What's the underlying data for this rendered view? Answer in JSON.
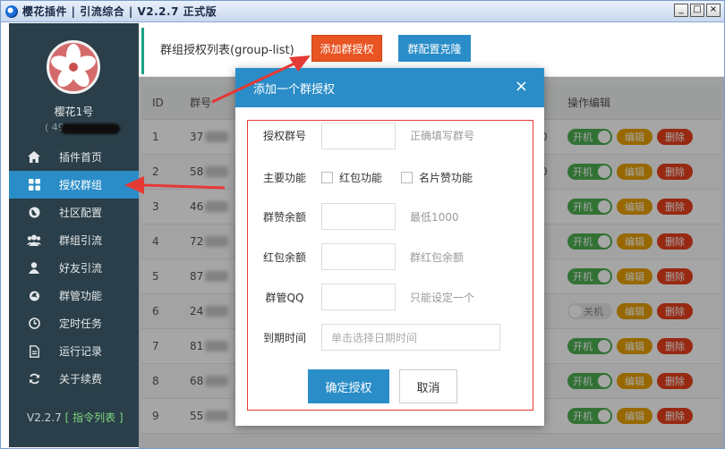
{
  "window": {
    "title": "樱花插件 | 引流综合 | V2.2.7 正式版",
    "min": "_",
    "max": "□",
    "close": "×"
  },
  "sidebar": {
    "username": "樱花1号",
    "uid": "( 49",
    "items": [
      {
        "label": "插件首页",
        "icon": "home-icon"
      },
      {
        "label": "授权群组",
        "icon": "grid-icon",
        "active": true
      },
      {
        "label": "社区配置",
        "icon": "globe-icon"
      },
      {
        "label": "群组引流",
        "icon": "group-icon"
      },
      {
        "label": "好友引流",
        "icon": "user-icon"
      },
      {
        "label": "群管功能",
        "icon": "fire-icon"
      },
      {
        "label": "定时任务",
        "icon": "clock-icon"
      },
      {
        "label": "运行记录",
        "icon": "file-icon"
      },
      {
        "label": "关于续费",
        "icon": "refresh-icon"
      }
    ],
    "version": "V2.2.7",
    "cmd_link": "[ 指令列表 ]"
  },
  "header": {
    "title": "群组授权列表(group-list)",
    "add_button": "添加群授权",
    "clone_button": "群配置克隆"
  },
  "table": {
    "columns": [
      "ID",
      "群号",
      "操作编辑"
    ],
    "rows": [
      {
        "id": "1",
        "gid": "37",
        "tail": "0",
        "on": true
      },
      {
        "id": "2",
        "gid": "58",
        "tail": "0",
        "on": true
      },
      {
        "id": "3",
        "gid": "46",
        "tail": "",
        "on": true
      },
      {
        "id": "4",
        "gid": "72",
        "tail": "",
        "on": true
      },
      {
        "id": "5",
        "gid": "87",
        "tail": "",
        "on": true
      },
      {
        "id": "6",
        "gid": "24",
        "tail": "",
        "on": false
      },
      {
        "id": "7",
        "gid": "81",
        "tail": "",
        "on": true
      },
      {
        "id": "8",
        "gid": "68",
        "tail": "",
        "on": true
      },
      {
        "id": "9",
        "gid": "55",
        "tail": "",
        "on": true
      }
    ],
    "switch_on": "开机",
    "switch_off": "关机",
    "edit": "编辑",
    "delete": "删除"
  },
  "dialog": {
    "title": "添加一个群授权",
    "close": "×",
    "group_label": "授权群号",
    "group_hint": "正确填写群号",
    "func_label": "主要功能",
    "func_redpacket": "红包功能",
    "func_likes": "名片赞功能",
    "like_label": "群赞余额",
    "like_hint": "最低1000",
    "red_label": "红包余额",
    "red_hint": "群红包余额",
    "admin_label": "群管QQ",
    "admin_hint": "只能设定一个",
    "expire_label": "到期时间",
    "expire_placeholder": "单击选择日期时间",
    "ok": "确定授权",
    "cancel": "取消"
  },
  "colors": {
    "accent": "#2a8dc8",
    "add": "#e85423",
    "sidebar": "#2a3f49",
    "on": "#4caf50",
    "edit": "#e8a000",
    "delete": "#e8401c",
    "annotation": "#e53935"
  }
}
